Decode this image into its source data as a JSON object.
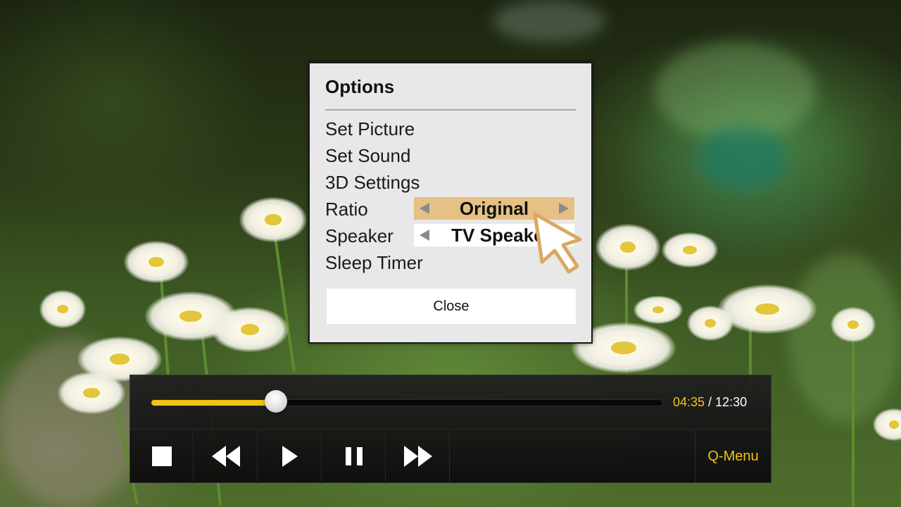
{
  "dialog": {
    "title": "Options",
    "items": {
      "set_picture": "Set Picture",
      "set_sound": "Set Sound",
      "settings_3d": "3D Settings",
      "ratio": "Ratio",
      "speaker": "Speaker",
      "sleep_timer": "Sleep Timer"
    },
    "ratio_value": "Original",
    "speaker_value": "TV Speaker",
    "close_label": "Close"
  },
  "player": {
    "current_time": "04:35",
    "separator": " / ",
    "total_time": "12:30",
    "progress_fraction": 0.2445,
    "q_menu_label": "Q-Menu",
    "controls": [
      "stop-icon",
      "rewind-icon",
      "play-icon",
      "pause-icon",
      "fast-forward-icon"
    ]
  },
  "colors": {
    "accent": "#f2c315",
    "highlight": "#e6c185",
    "dialog_bg": "#e8e8e8"
  }
}
